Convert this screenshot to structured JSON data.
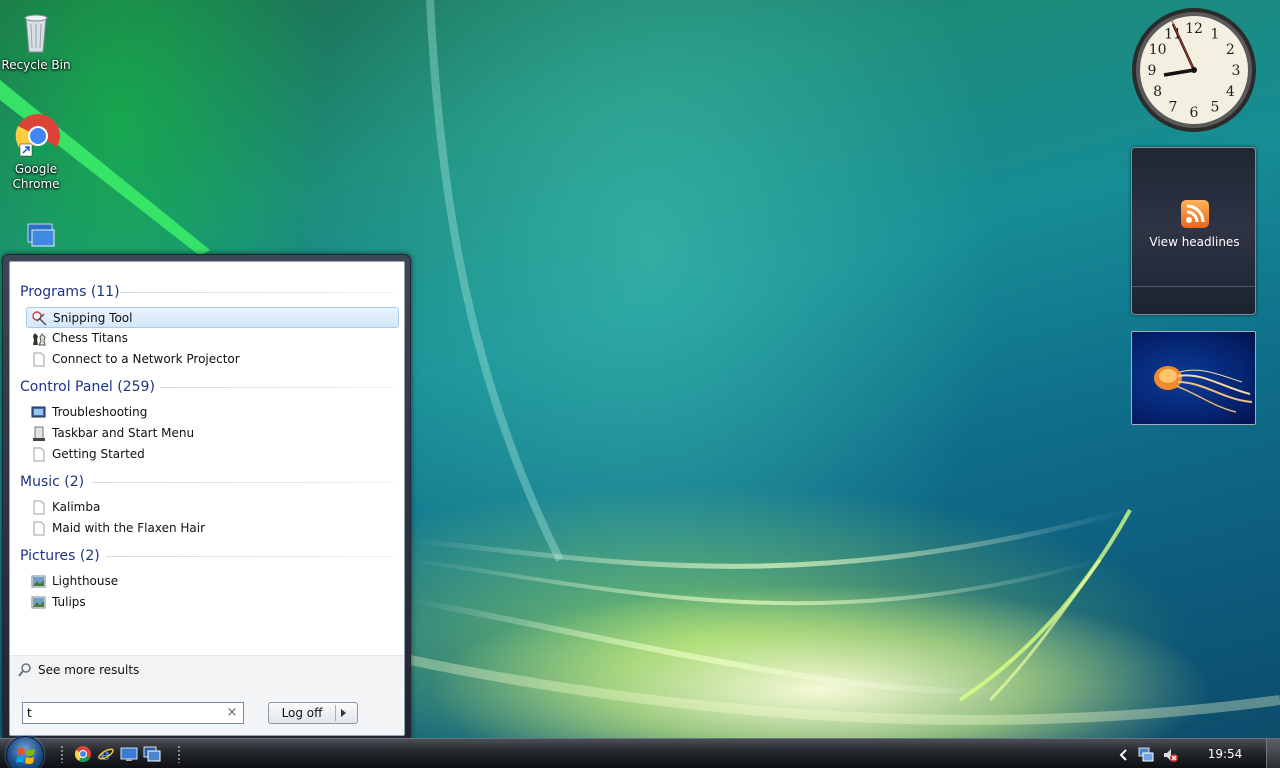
{
  "desktop": {
    "icons": [
      {
        "label": "Recycle Bin",
        "icon": "recycle-bin-icon"
      },
      {
        "label": "Google Chrome",
        "icon": "chrome-icon"
      },
      {
        "label": "",
        "icon": "network-computer-icon"
      }
    ]
  },
  "gadgets": {
    "clock": {
      "hour_labels": [
        "12",
        "1",
        "2",
        "3",
        "4",
        "5",
        "6",
        "7",
        "8",
        "9",
        "10",
        "11"
      ],
      "time": "9:54"
    },
    "feed": {
      "label": "View headlines",
      "icon": "rss-icon"
    },
    "slideshow": {
      "picture": "jellyfish"
    }
  },
  "start_menu": {
    "groups": [
      {
        "title": "Programs (11)",
        "items": [
          {
            "label": "Snipping Tool",
            "icon": "snipping-tool-icon",
            "selected": true
          },
          {
            "label": "Chess Titans",
            "icon": "chess-icon"
          },
          {
            "label": "Connect to a Network Projector",
            "icon": "document-icon"
          }
        ]
      },
      {
        "title": "Control Panel (259)",
        "items": [
          {
            "label": "Troubleshooting",
            "icon": "troubleshooting-icon"
          },
          {
            "label": "Taskbar and Start Menu",
            "icon": "taskbar-icon"
          },
          {
            "label": "Getting Started",
            "icon": "document-icon"
          }
        ]
      },
      {
        "title": "Music (2)",
        "items": [
          {
            "label": "Kalimba",
            "icon": "document-icon"
          },
          {
            "label": "Maid with the Flaxen Hair",
            "icon": "document-icon"
          }
        ]
      },
      {
        "title": "Pictures (2)",
        "items": [
          {
            "label": "Lighthouse",
            "icon": "picture-icon"
          },
          {
            "label": "Tulips",
            "icon": "picture-icon"
          }
        ]
      }
    ],
    "see_more": "See more results",
    "search": {
      "value": "t",
      "clear_glyph": "×"
    },
    "log_off": "Log off"
  },
  "taskbar": {
    "quick_launch": [
      "chrome-icon",
      "internet-explorer-icon",
      "show-desktop-icon",
      "switch-windows-icon"
    ],
    "tray": [
      "chevron-left-icon",
      "network-icon",
      "volume-muted-icon"
    ],
    "time": "19:54"
  }
}
